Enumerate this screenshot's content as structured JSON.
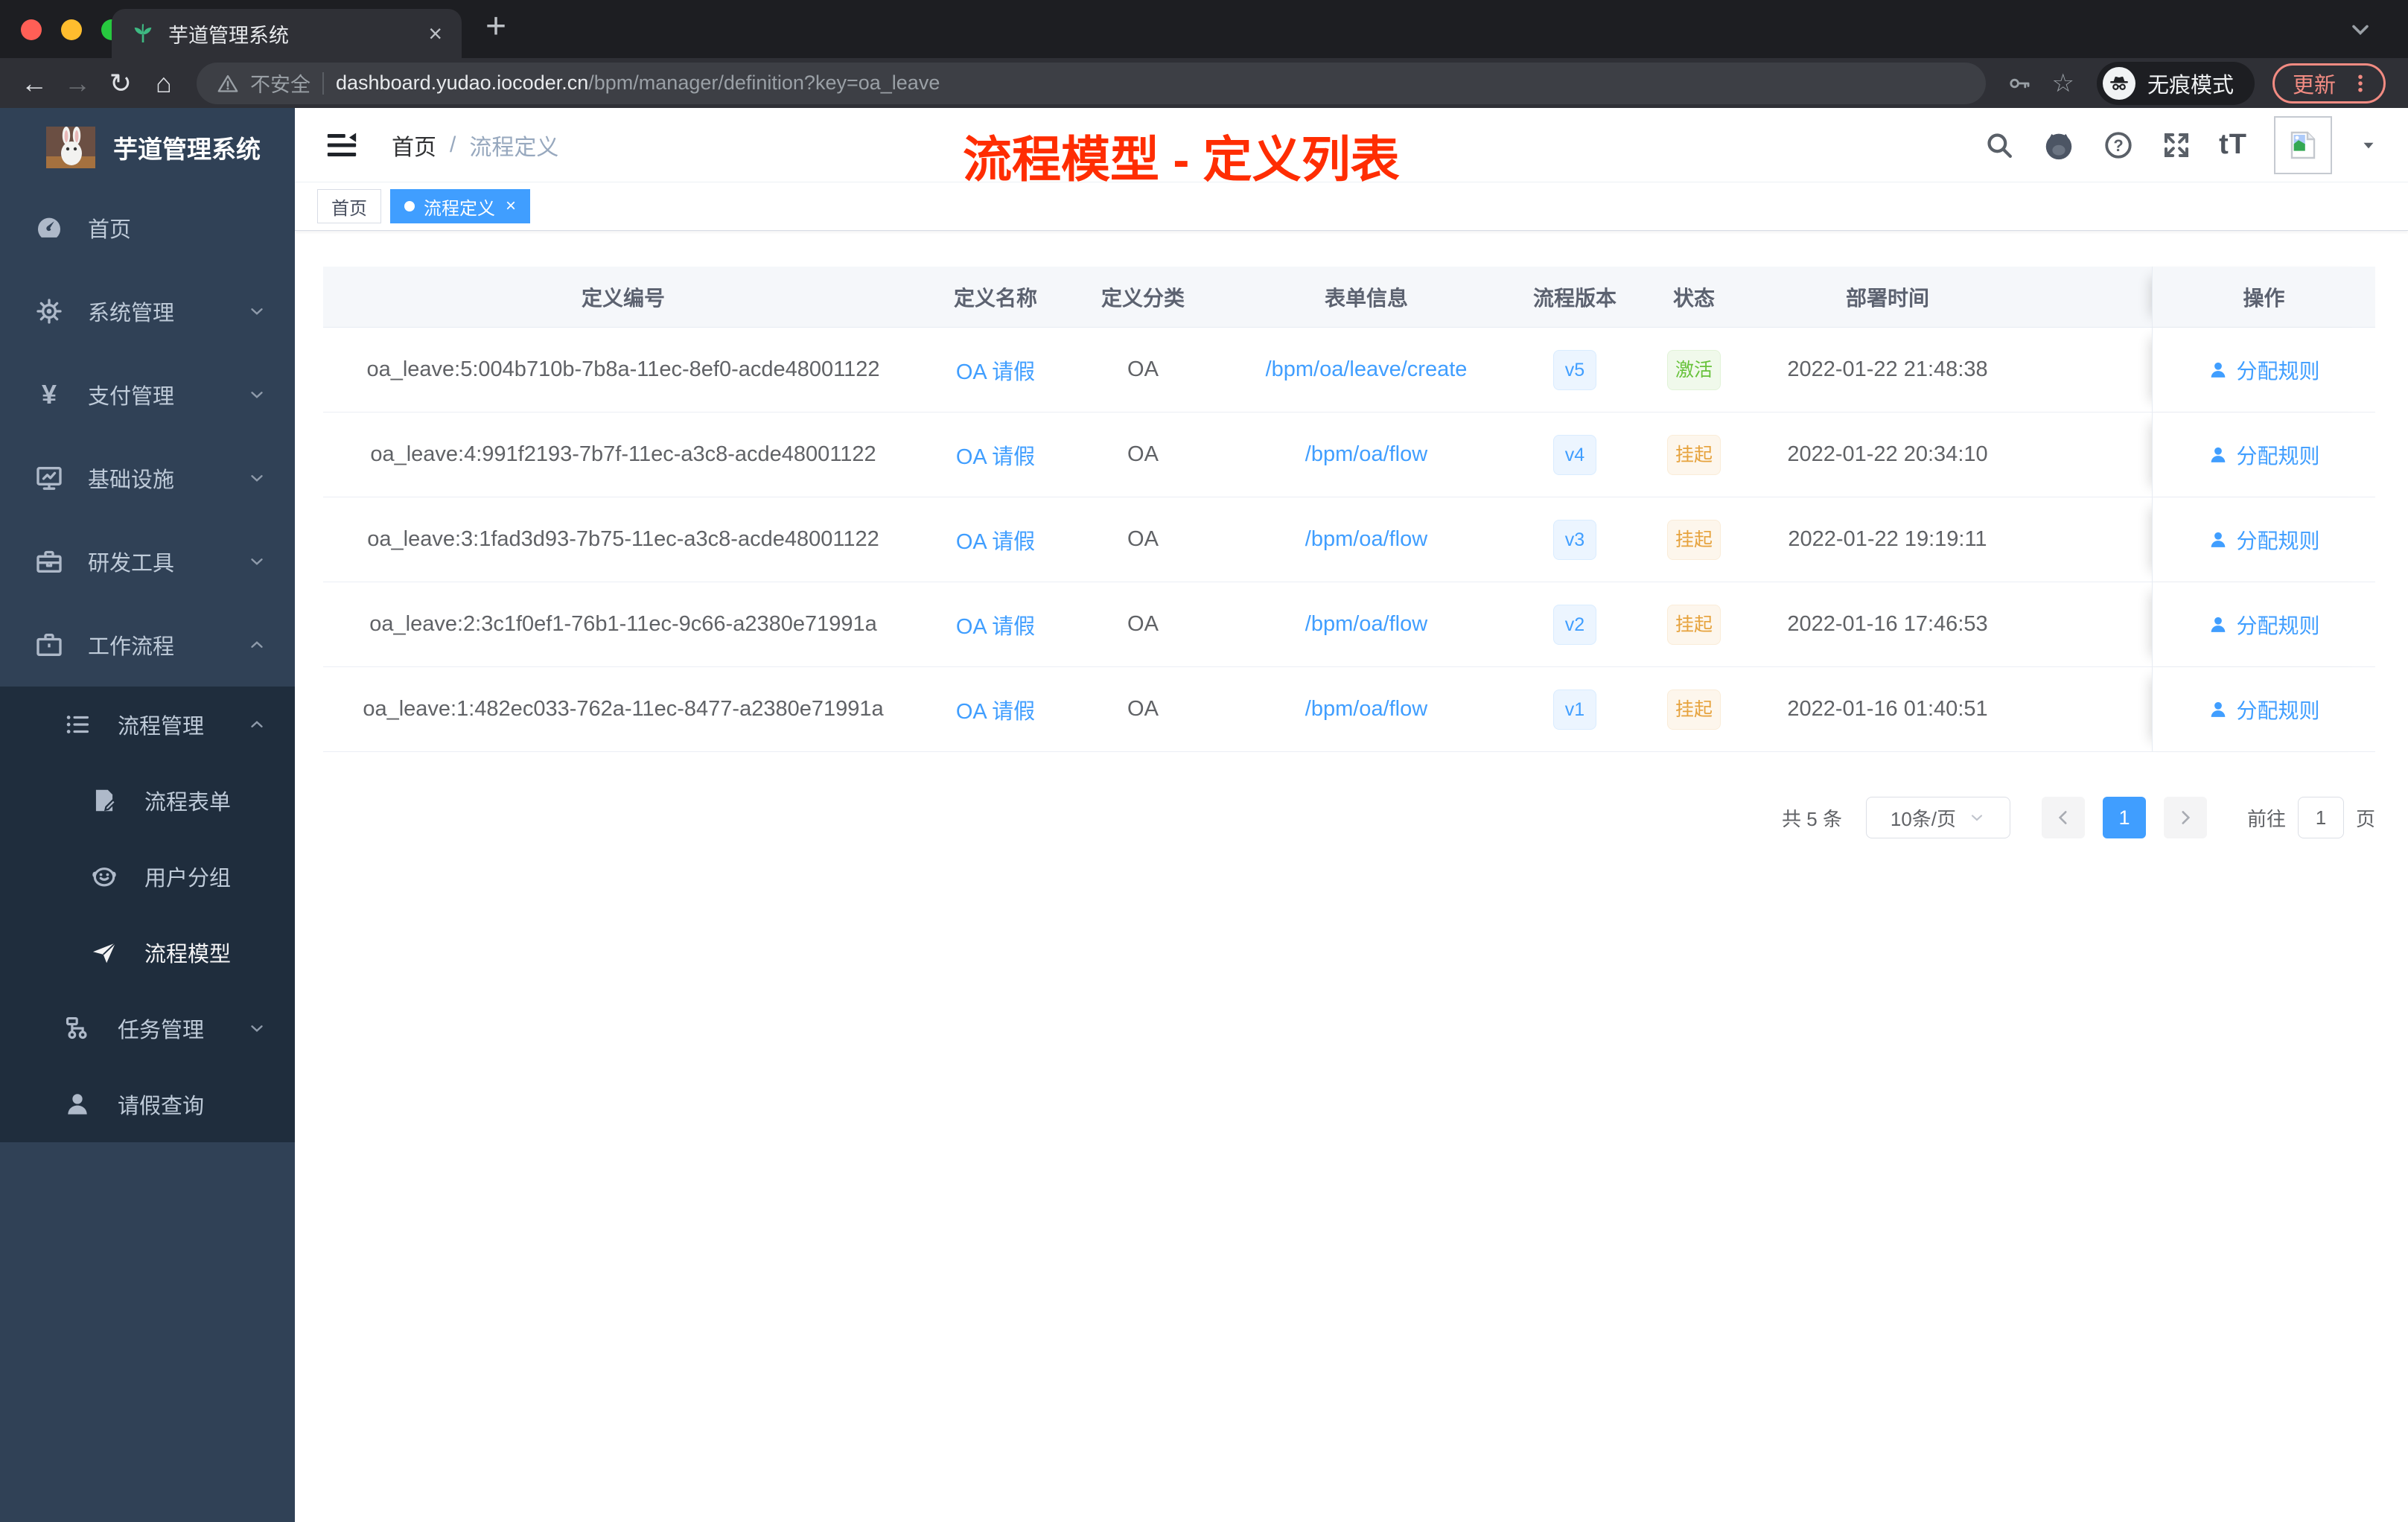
{
  "browser": {
    "tab": {
      "title": "芋道管理系统",
      "close": "×",
      "new_tab": "+"
    },
    "toolbar": {
      "back": "←",
      "forward": "→",
      "reload": "↻",
      "home": "⌂",
      "security": "不安全",
      "url_host": "dashboard.yudao.iocoder.cn",
      "url_path": "/bpm/manager/definition?key=oa_leave",
      "star": "☆",
      "incognito": "无痕模式",
      "update": "更新"
    }
  },
  "sidebar": {
    "title": "芋道管理系统",
    "items": [
      {
        "label": "首页"
      },
      {
        "label": "系统管理"
      },
      {
        "label": "支付管理"
      },
      {
        "label": "基础设施"
      },
      {
        "label": "研发工具"
      },
      {
        "label": "工作流程"
      }
    ],
    "sub": [
      {
        "label": "流程管理"
      },
      {
        "label": "流程表单"
      },
      {
        "label": "用户分组"
      },
      {
        "label": "流程模型"
      },
      {
        "label": "任务管理"
      },
      {
        "label": "请假查询"
      }
    ]
  },
  "navbar": {
    "breadcrumb_home": "首页",
    "breadcrumb_sep": "/",
    "breadcrumb_current": "流程定义",
    "text_size_icon": "tT"
  },
  "annotation": {
    "text": "流程模型 - 定义列表",
    "color": "#ff2d02"
  },
  "tags": {
    "home": "首页",
    "active": "流程定义",
    "close": "×"
  },
  "table": {
    "headers": {
      "id": "定义编号",
      "name": "定义名称",
      "category": "定义分类",
      "form": "表单信息",
      "version": "流程版本",
      "status": "状态",
      "deploy_time": "部署时间",
      "actions": "操作"
    },
    "action_label": "分配规则",
    "rows": [
      {
        "id": "oa_leave:5:004b710b-7b8a-11ec-8ef0-acde48001122",
        "name": "OA 请假",
        "category": "OA",
        "form": "/bpm/oa/leave/create",
        "version": "v5",
        "status": "激活",
        "time": "2022-01-22 21:48:38"
      },
      {
        "id": "oa_leave:4:991f2193-7b7f-11ec-a3c8-acde48001122",
        "name": "OA 请假",
        "category": "OA",
        "form": "/bpm/oa/flow",
        "version": "v4",
        "status": "挂起",
        "time": "2022-01-22 20:34:10"
      },
      {
        "id": "oa_leave:3:1fad3d93-7b75-11ec-a3c8-acde48001122",
        "name": "OA 请假",
        "category": "OA",
        "form": "/bpm/oa/flow",
        "version": "v3",
        "status": "挂起",
        "time": "2022-01-22 19:19:11"
      },
      {
        "id": "oa_leave:2:3c1f0ef1-76b1-11ec-9c66-a2380e71991a",
        "name": "OA 请假",
        "category": "OA",
        "form": "/bpm/oa/flow",
        "version": "v2",
        "status": "挂起",
        "time": "2022-01-16 17:46:53"
      },
      {
        "id": "oa_leave:1:482ec033-762a-11ec-8477-a2380e71991a",
        "name": "OA 请假",
        "category": "OA",
        "form": "/bpm/oa/flow",
        "version": "v1",
        "status": "挂起",
        "time": "2022-01-16 01:40:51"
      }
    ]
  },
  "pagination": {
    "total": "共 5 条",
    "page_size": "10条/页",
    "prev": "‹",
    "page": "1",
    "next": "›",
    "goto_label": "前往",
    "goto_value": "1",
    "unit": "页"
  },
  "colors": {
    "accent": "#409eff",
    "link": "#409eff",
    "success_text": "#67c23a",
    "success_bg": "#f0f9eb",
    "warning_text": "#e6a23c",
    "warning_bg": "#fdf6ec",
    "sidebar_bg": "#304156",
    "submenu_bg": "#1f2d3d",
    "annotation": "#ff2d02",
    "update_button": "#f28b82",
    "active_tag": "#409eff"
  }
}
